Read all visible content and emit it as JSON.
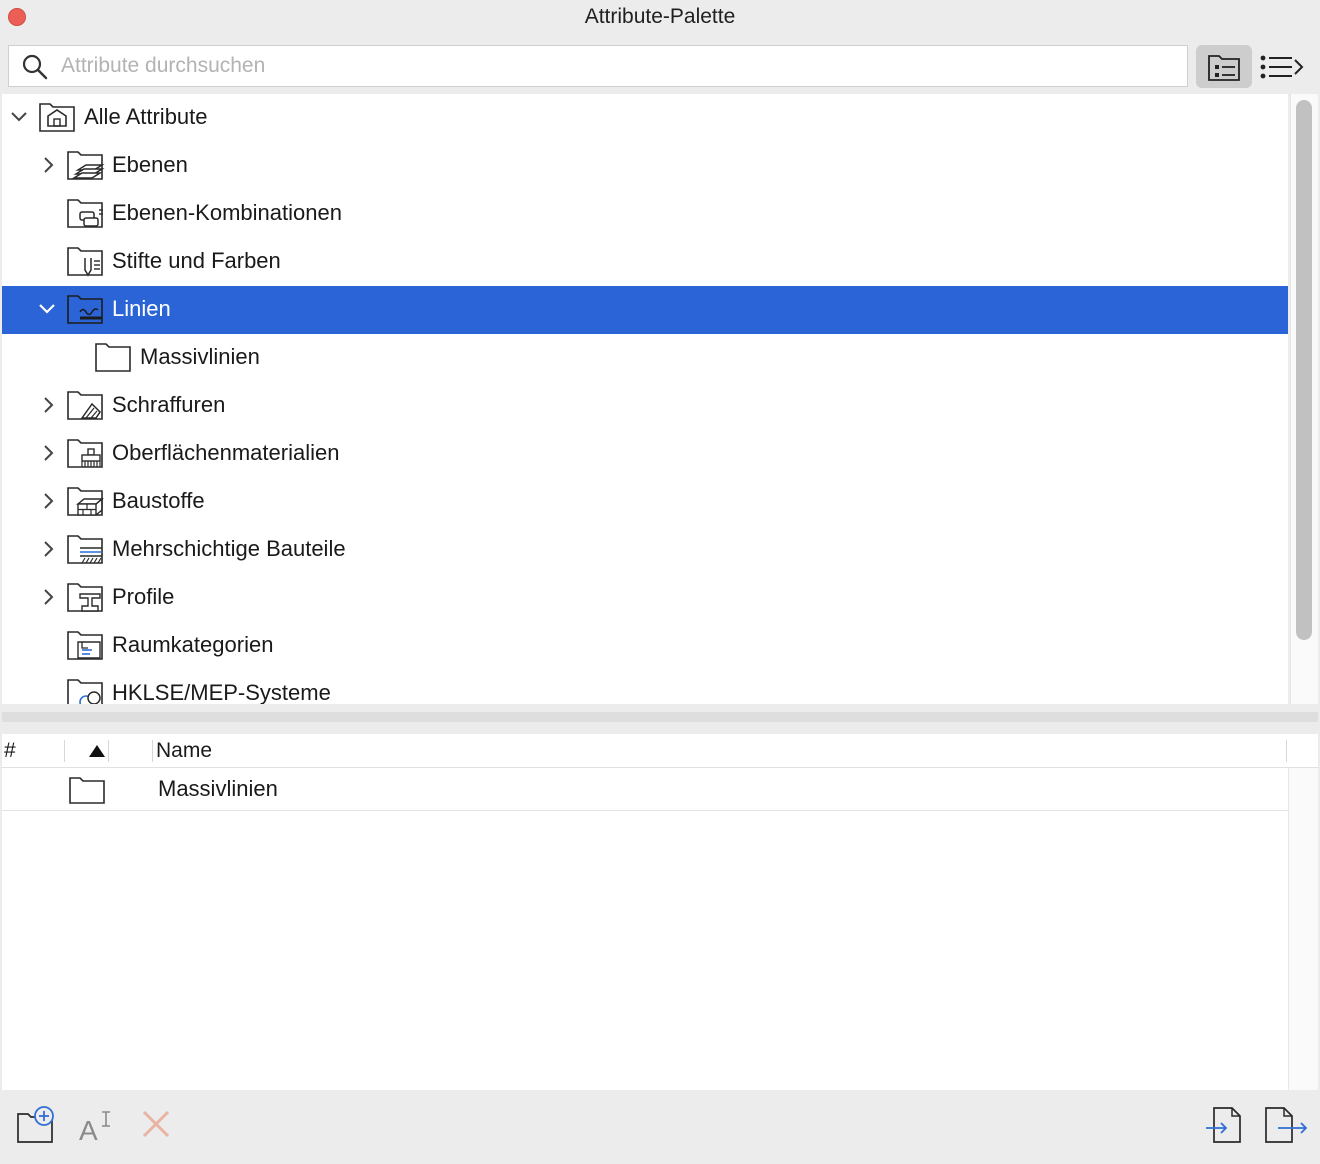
{
  "window": {
    "title": "Attribute-Palette"
  },
  "search": {
    "placeholder": "Attribute durchsuchen",
    "value": ""
  },
  "tree": {
    "items": [
      {
        "label": "Alle Attribute",
        "expanded": true,
        "level": 0
      },
      {
        "label": "Ebenen",
        "expandable": true,
        "level": 1
      },
      {
        "label": "Ebenen-Kombinationen",
        "level": 1
      },
      {
        "label": "Stifte und Farben",
        "level": 1
      },
      {
        "label": "Linien",
        "expanded": true,
        "selected": true,
        "level": 1
      },
      {
        "label": "Massivlinien",
        "level": 2
      },
      {
        "label": "Schraffuren",
        "expandable": true,
        "level": 1
      },
      {
        "label": "Oberflächenmaterialien",
        "expandable": true,
        "level": 1
      },
      {
        "label": "Baustoffe",
        "expandable": true,
        "level": 1
      },
      {
        "label": "Mehrschichtige Bauteile",
        "expandable": true,
        "level": 1
      },
      {
        "label": "Profile",
        "expandable": true,
        "level": 1
      },
      {
        "label": "Raumkategorien",
        "level": 1
      },
      {
        "label": "HKLSE/MEP-Systeme",
        "level": 1
      }
    ]
  },
  "list": {
    "columns": {
      "number": "#",
      "name": "Name"
    },
    "rows": [
      {
        "name": "Massivlinien"
      }
    ]
  },
  "colors": {
    "selection": "#2b64d7",
    "accent_icon": "#2f6fd6",
    "delete_disabled": "#eab3a4"
  },
  "bottom_toolbar": {
    "icons": [
      "new-folder-icon",
      "rename-icon",
      "delete-icon",
      "import-icon",
      "export-icon"
    ]
  }
}
